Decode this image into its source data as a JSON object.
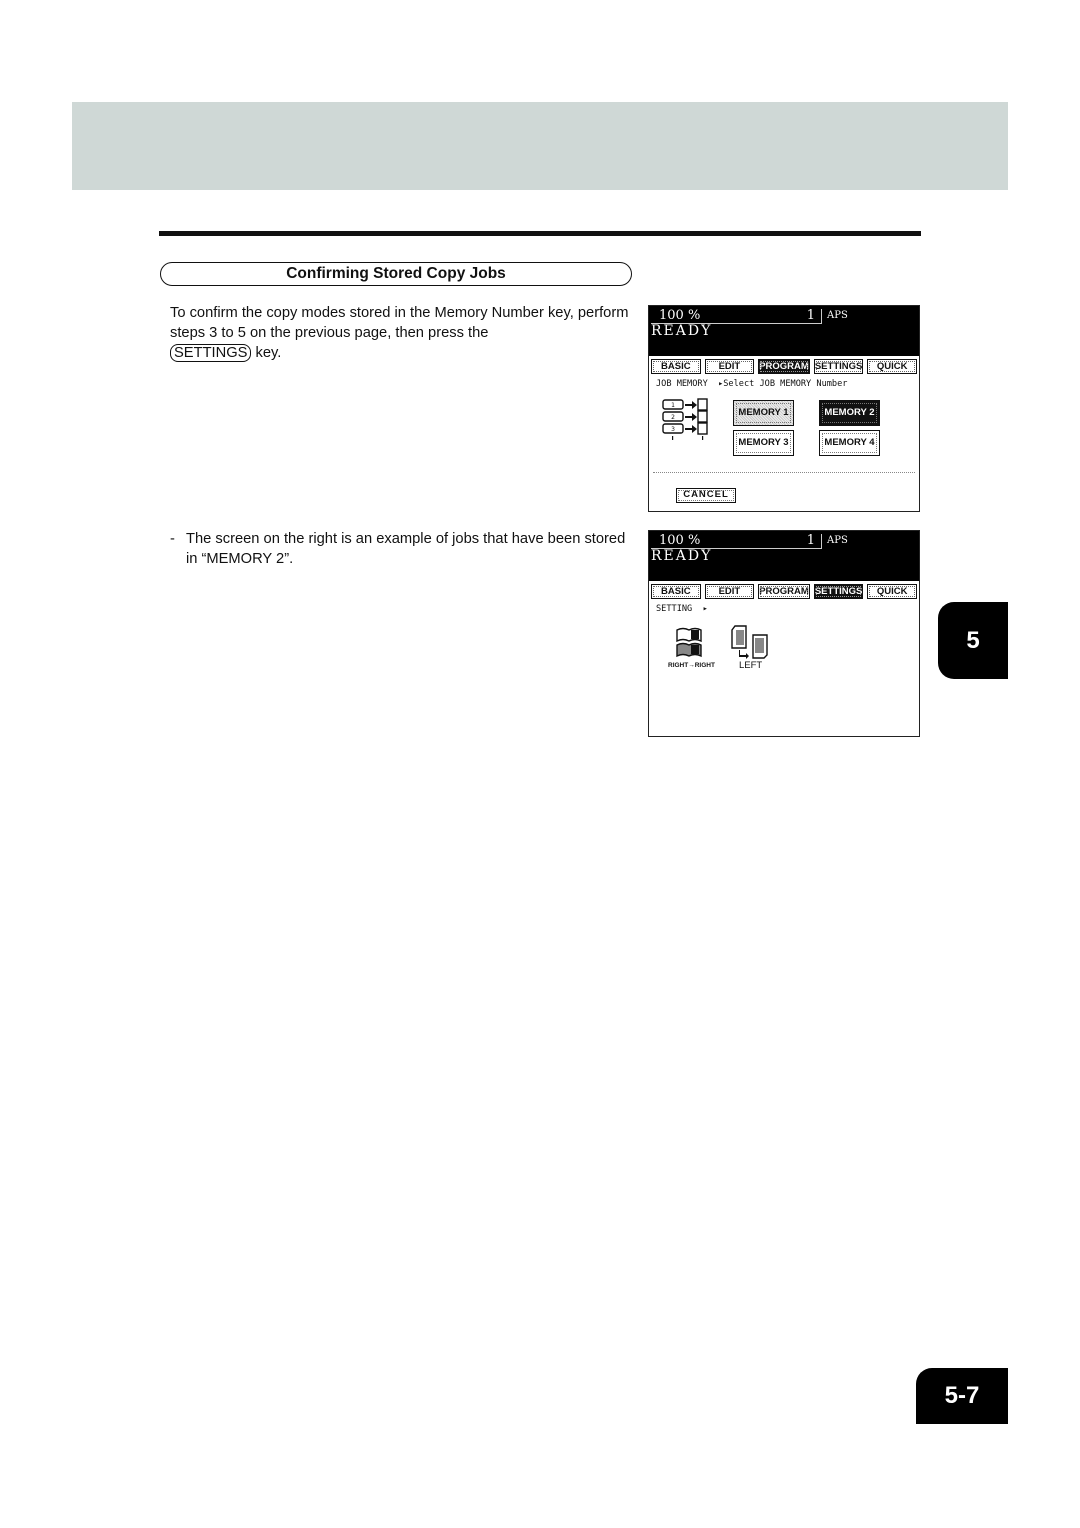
{
  "section": {
    "title": "Confirming Stored Copy Jobs",
    "intro_part1": "To confirm the copy modes stored in the Memory Number key, perform steps 3 to 5 on the previous page, then press the",
    "key_label": "SETTINGS",
    "intro_part2": "key.",
    "note_dash": "-",
    "note": "The screen on the right is an example of jobs that have been stored in “MEMORY 2”."
  },
  "screen1": {
    "ratio": "100 %",
    "count": "1",
    "paper": "APS",
    "status": "READY",
    "tabs": [
      "BASIC",
      "EDIT",
      "PROGRAM",
      "SETTINGS",
      "QUICK"
    ],
    "active_tab": "PROGRAM",
    "breadcrumb": "JOB MEMORY  ▸Select JOB MEMORY Number",
    "memory_buttons": [
      "MEMORY 1",
      "MEMORY 2",
      "MEMORY 3",
      "MEMORY 4"
    ],
    "selected_memory": "MEMORY 2",
    "cancel": "CANCEL"
  },
  "screen2": {
    "ratio": "100 %",
    "count": "1",
    "paper": "APS",
    "status": "READY",
    "tabs": [
      "BASIC",
      "EDIT",
      "PROGRAM",
      "SETTINGS",
      "QUICK"
    ],
    "active_tab": "SETTINGS",
    "breadcrumb": "SETTING  ▸",
    "settings": [
      {
        "icon": "book-duplex-icon",
        "label": "RIGHT→RIGHT"
      },
      {
        "icon": "page-rotate-icon",
        "label": "LEFT"
      }
    ]
  },
  "chapter_tab": "5",
  "page_number": "5-7"
}
